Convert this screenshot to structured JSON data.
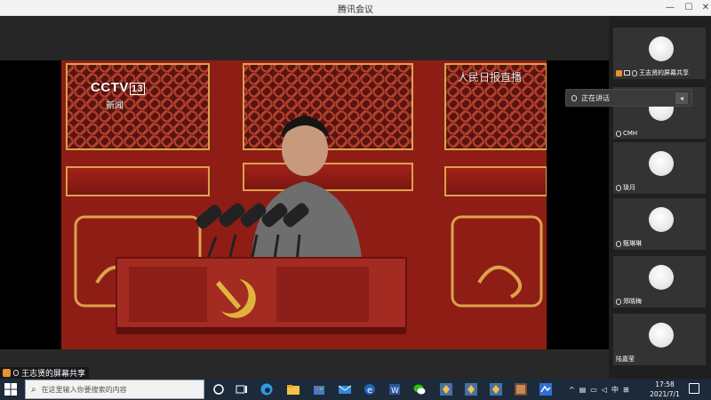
{
  "window": {
    "title": "腾讯会议"
  },
  "share": {
    "label": "王志贤的屏幕共享",
    "broadcast": {
      "logo": "CCTV",
      "channel": "13",
      "caption": "新闻",
      "watermark": "人民日报直播"
    },
    "speaker_badge": "speaker"
  },
  "speaking_popup": {
    "label": "正在讲话"
  },
  "participants": [
    {
      "name": "王志贤的屏幕共享",
      "host": true
    },
    {
      "name": "CMH"
    },
    {
      "name": "琰月"
    },
    {
      "name": "甄琳琳"
    },
    {
      "name": "郑晓梅"
    },
    {
      "name": "陆嘉莹"
    }
  ],
  "taskbar": {
    "search_placeholder": "在这里输入你要搜索的内容",
    "apps": [
      "task-view-icon",
      "edge-icon",
      "file-explorer-icon",
      "store-icon",
      "mail-icon",
      "ie-icon",
      "word-icon",
      "wechat-icon",
      "app-icon",
      "app-icon",
      "app-icon",
      "photo-icon",
      "meeting-icon"
    ],
    "tray_lang": "中",
    "time": "17:58",
    "date": "2021/7/1"
  },
  "colors": {
    "accent": "#1e90ff",
    "taskbar": "#1c2a3a",
    "panel": "#333333",
    "red": "#8a1b12"
  }
}
